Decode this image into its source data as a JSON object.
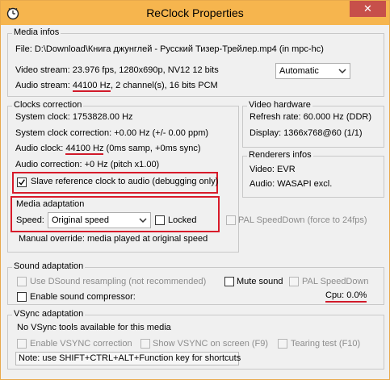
{
  "window": {
    "title": "ReClock Properties",
    "close_glyph": "✕"
  },
  "media_infos": {
    "group_title": "Media infos",
    "file_line": "File:  D:\\Download\\Книга джунглей - Русский Тизер-Трейлер.mp4 (in mpc-hc)",
    "video_line": "Video stream:  23.976 fps, 1280x690p, NV12 12 bits",
    "audio_prefix": "Audio stream: ",
    "audio_hz": "44100 Hz",
    "audio_suffix": ", 2 channel(s), 16 bits PCM",
    "mode_dropdown": "Automatic"
  },
  "clocks": {
    "group_title": "Clocks correction",
    "system_clock": "System clock:  1753828.00 Hz",
    "system_correction": "System clock correction: +0.00 Hz (+/- 0.00 ppm)",
    "audio_clock_prefix": "Audio clock: ",
    "audio_clock_hz": "44100 Hz",
    "audio_clock_suffix": " (0ms samp, +0ms sync)",
    "audio_correction": "Audio correction:  +0 Hz (pitch x1.00)",
    "slave_label": "Slave reference clock to audio (debugging only)",
    "slave_checked": true
  },
  "video_hardware": {
    "group_title": "Video hardware",
    "refresh_rate": "Refresh rate: 60.000 Hz (DDR)",
    "display": "Display:  1366x768@60 (1/1)"
  },
  "renderers": {
    "group_title": "Renderers infos",
    "video": "Video: EVR",
    "audio": "Audio:  WASAPI excl."
  },
  "media_adaptation": {
    "group_title": "Media adaptation",
    "speed_label": "Speed:",
    "speed_value": "Original speed",
    "locked_label": "Locked",
    "locked_checked": false,
    "pal_label": "PAL SpeedDown (force to 24fps)",
    "manual_override": "Manual override: media played at original speed"
  },
  "sound_adaptation": {
    "group_title": "Sound adaptation",
    "dsound_label": "Use DSound resampling (not recommended)",
    "mute_label": "Mute sound",
    "pal_label": "PAL SpeedDown",
    "compressor_label": "Enable sound compressor:",
    "cpu": "Cpu: 0.0%"
  },
  "vsync": {
    "group_title": "VSync adaptation",
    "status": "No VSync tools available for this media",
    "enable_label": "Enable VSYNC correction",
    "show_label": "Show VSYNC on screen (F9)",
    "tearing_label": "Tearing test (F10)",
    "note": "Note: use SHIFT+CTRL+ALT+Function key for shortcuts"
  },
  "colors": {
    "title_bar": "#f6b54e",
    "close_button": "#c7504a",
    "annotation_red": "#d81b2a"
  }
}
